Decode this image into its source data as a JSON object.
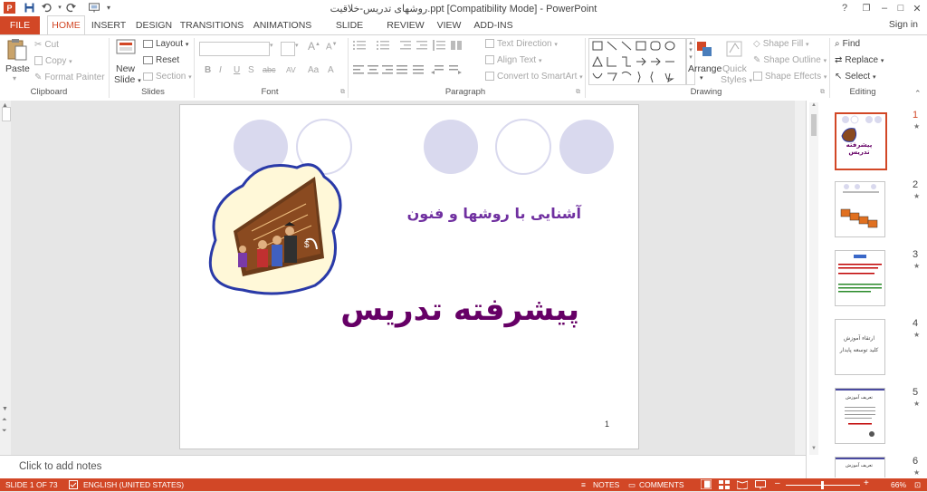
{
  "window": {
    "title": "روشهای تدریس-خلاقیت.ppt [Compatibility Mode] - PowerPoint",
    "app_icon": "P",
    "controls": [
      "?",
      "❐",
      "–",
      "□",
      "✕"
    ]
  },
  "quick_access": {
    "icons": [
      "save-icon",
      "undo-icon",
      "redo-icon",
      "start-from-beginning-icon",
      "customize-qat-icon"
    ]
  },
  "tabs": [
    {
      "label": "FILE"
    },
    {
      "label": "HOME"
    },
    {
      "label": "INSERT"
    },
    {
      "label": "DESIGN"
    },
    {
      "label": "TRANSITIONS"
    },
    {
      "label": "ANIMATIONS"
    },
    {
      "label": "SLIDE SHOW"
    },
    {
      "label": "REVIEW"
    },
    {
      "label": "VIEW"
    },
    {
      "label": "ADD-INS"
    }
  ],
  "signin": "Sign in",
  "ribbon": {
    "clipboard": {
      "paste": "Paste",
      "cut": "Cut",
      "copy": "Copy",
      "format_painter": "Format Painter",
      "label": "Clipboard"
    },
    "slides": {
      "new_slide_1": "New",
      "new_slide_2": "Slide",
      "layout": "Layout",
      "reset": "Reset",
      "section": "Section",
      "label": "Slides"
    },
    "font": {
      "label": "Font",
      "buttons": [
        "B",
        "I",
        "U",
        "S",
        "abc",
        "AV",
        "Aa",
        "A"
      ]
    },
    "paragraph": {
      "text_direction": "Text Direction",
      "align_text": "Align Text",
      "convert_smartart": "Convert to SmartArt",
      "label": "Paragraph"
    },
    "drawing": {
      "arrange": "Arrange",
      "quick_1": "Quick",
      "quick_2": "Styles",
      "shape_fill": "Shape Fill",
      "shape_outline": "Shape Outline",
      "shape_effects": "Shape Effects",
      "label": "Drawing"
    },
    "editing": {
      "find": "Find",
      "replace": "Replace",
      "select": "Select",
      "label": "Editing"
    }
  },
  "slide": {
    "subtitle": "آشنایی با روشها و فنون",
    "title": "پیشرفته تدریس",
    "page_number": "1",
    "circle_fill": "#d9d9ee",
    "circle_stroke": "#d9d9ee",
    "title_color": "#660066",
    "subtitle_color": "#7030a0"
  },
  "thumbnails": [
    {
      "num": "1",
      "star": "★",
      "title": "پیشرفته تدریس",
      "selected": true
    },
    {
      "num": "2",
      "star": "★",
      "title": "",
      "selected": false
    },
    {
      "num": "3",
      "star": "★",
      "title": "",
      "selected": false
    },
    {
      "num": "4",
      "star": "★",
      "title": "ارتقاء آموزش",
      "sub": "کلید توسعه پایدار",
      "selected": false
    },
    {
      "num": "5",
      "star": "★",
      "title": "تعریف آموزش",
      "selected": false
    },
    {
      "num": "6",
      "star": "★",
      "title": "تعریف آموزش",
      "selected": false
    }
  ],
  "notes": "Click to add notes",
  "status": {
    "slide_info": "SLIDE 1 OF 73",
    "language": "ENGLISH (UNITED STATES)",
    "notes": "NOTES",
    "comments": "COMMENTS",
    "zoom": "66%",
    "minus": "–",
    "plus": "+"
  },
  "colors": {
    "accent": "#d24726",
    "statusbar": "#d24726"
  }
}
